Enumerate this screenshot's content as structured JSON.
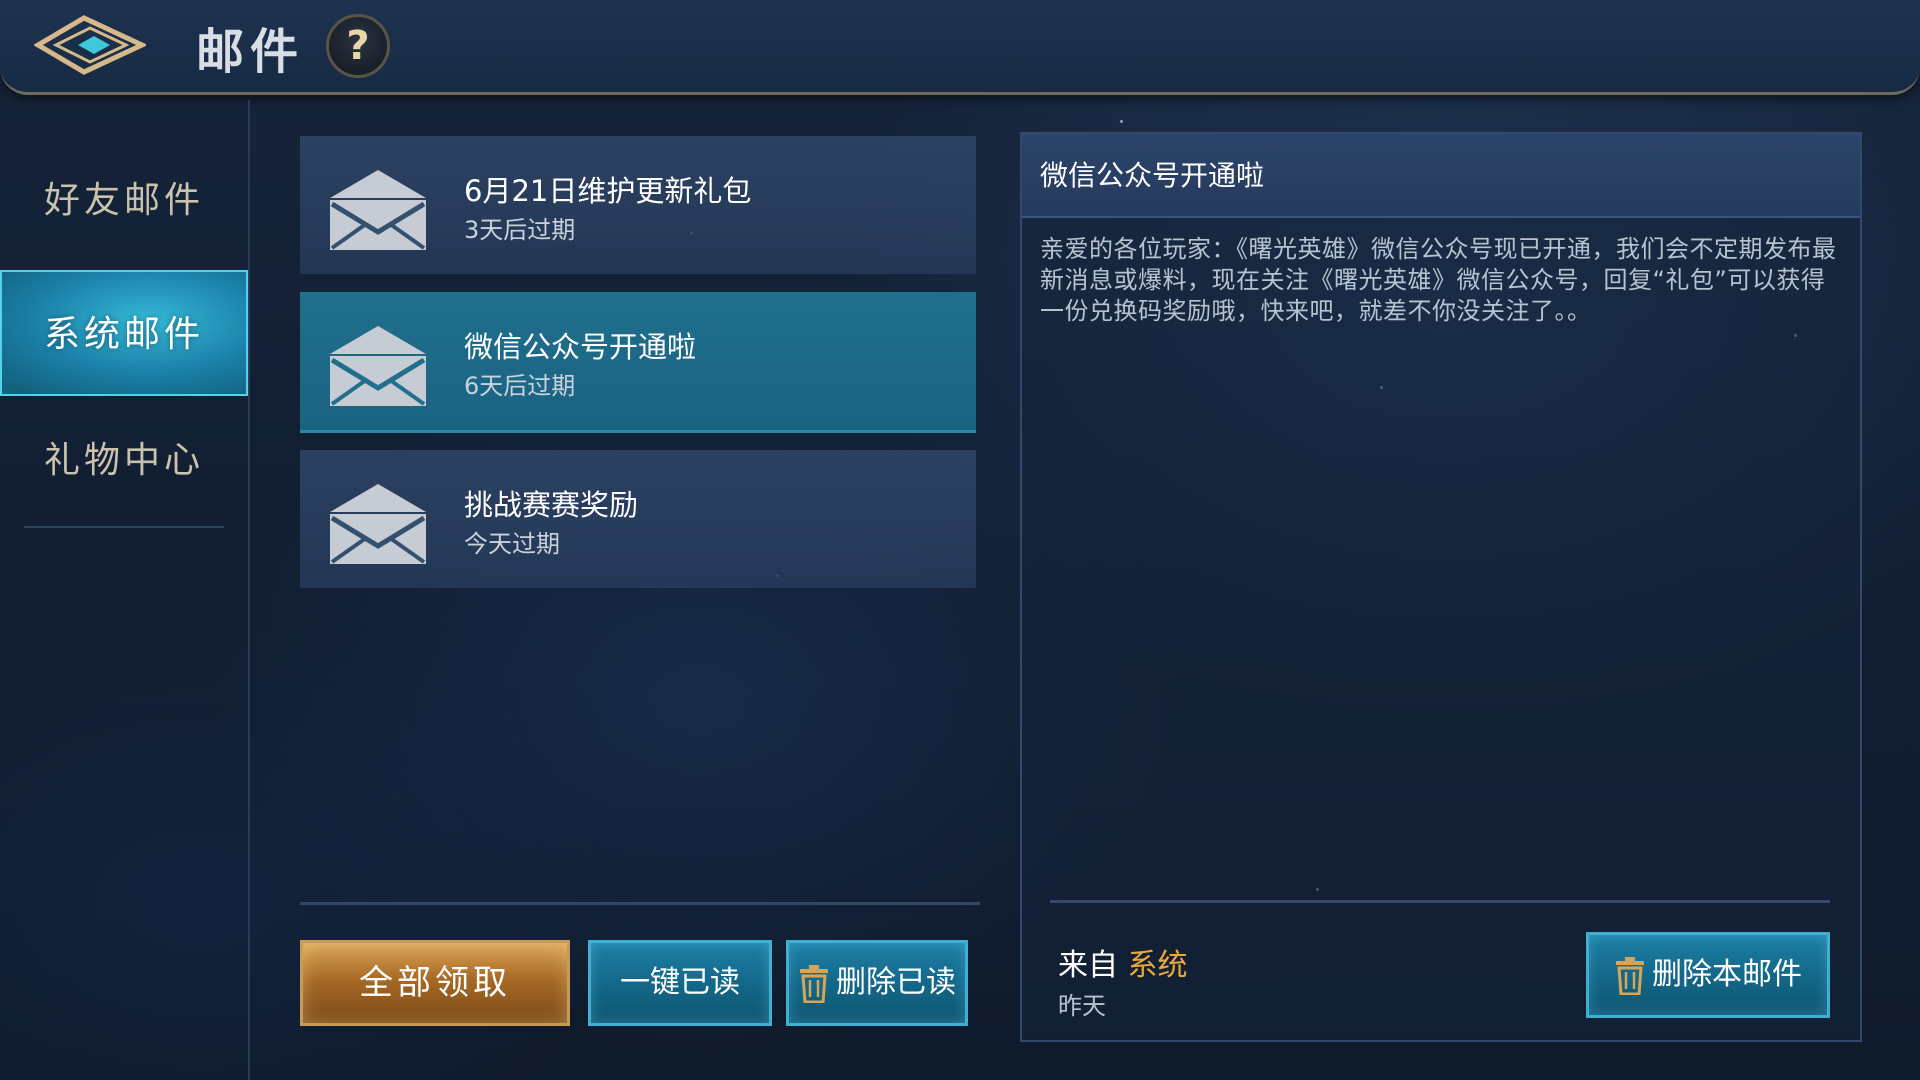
{
  "header": {
    "title": "邮件",
    "help_label": "?"
  },
  "sidebar": {
    "items": [
      {
        "label": "好友邮件",
        "active": false
      },
      {
        "label": "系统邮件",
        "active": true
      },
      {
        "label": "礼物中心",
        "active": false
      }
    ]
  },
  "mail_list": [
    {
      "title": "6月21日维护更新礼包",
      "expire": "3天后过期",
      "selected": false
    },
    {
      "title": "微信公众号开通啦",
      "expire": "6天后过期",
      "selected": true
    },
    {
      "title": "挑战赛赛奖励",
      "expire": "今天过期",
      "selected": false
    }
  ],
  "actions": {
    "claim_all": "全部领取",
    "mark_all_read": "一键已读",
    "delete_read": "删除已读"
  },
  "detail": {
    "title": "微信公众号开通啦",
    "body": "亲爱的各位玩家：《曙光英雄》微信公众号现已开通，我们会不定期发布最新消息或爆料，现在关注《曙光英雄》微信公众号，回复“礼包”可以获得一份兑换码奖励哦，快来吧，就差不你没关注了。。",
    "from_prefix": "来自",
    "from_sender": "系统",
    "sent_time": "昨天",
    "delete_label": "删除本邮件"
  },
  "colors": {
    "accent_cyan": "#1f6f8d",
    "gold": "#a86a26",
    "sender_highlight": "#e9a93a"
  },
  "icons": {
    "back": "back-arrow-icon",
    "help": "question-icon",
    "mail": "envelope-icon",
    "delete": "trash-icon"
  }
}
